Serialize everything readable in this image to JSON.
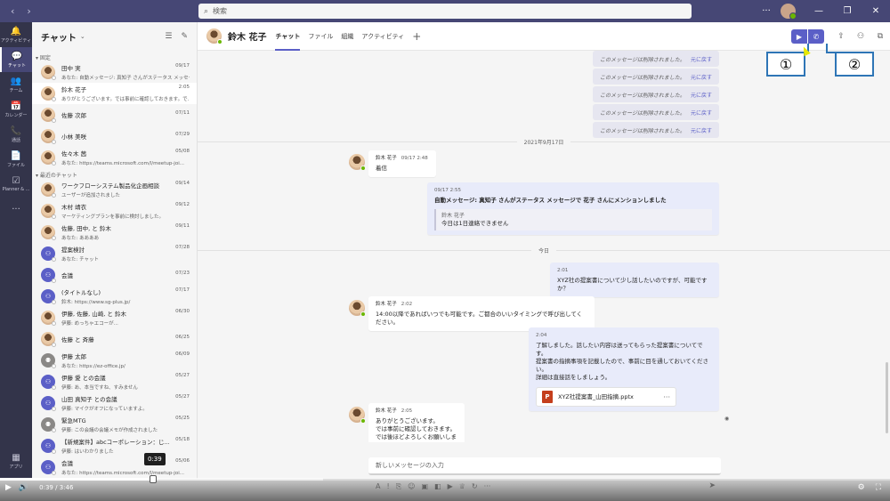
{
  "titlebar": {
    "back_icon": "chevron-left-icon",
    "forward_icon": "chevron-right-icon",
    "search_placeholder": "検索",
    "more": "···",
    "minimize": "—",
    "maximize": "❐",
    "close": "✕"
  },
  "rail": {
    "items": [
      {
        "icon": "bell-icon",
        "glyph": "🔔",
        "label": "アクティビティ"
      },
      {
        "icon": "chat-icon",
        "glyph": "💬",
        "label": "チャット",
        "active": true
      },
      {
        "icon": "teams-icon",
        "glyph": "👥",
        "label": "チーム"
      },
      {
        "icon": "calendar-icon",
        "glyph": "📅",
        "label": "カレンダー"
      },
      {
        "icon": "phone-icon",
        "glyph": "📞",
        "label": "通話"
      },
      {
        "icon": "file-icon",
        "glyph": "📄",
        "label": "ファイル"
      },
      {
        "icon": "planner-icon",
        "glyph": "☑",
        "label": "Planner & ..."
      },
      {
        "icon": "more-icon",
        "glyph": "···",
        "label": ""
      }
    ],
    "apps_label": "アプリ",
    "apps_glyph": "▦"
  },
  "chatlist": {
    "title": "チャット",
    "pinned_label": "固定",
    "recent_label": "最近のチャット",
    "pinned": [
      {
        "name": "田中 実",
        "time": "09/17",
        "preview": "あなた: 自動メッセージ: 真知子 さんがステータス メッセー...",
        "avatar": "person"
      },
      {
        "name": "鈴木 花子",
        "time": "2:05",
        "preview": "ありがとうございます。では事前に確認しておきます。で...",
        "avatar": "person",
        "selected": true
      },
      {
        "name": "佐藤 次郎",
        "time": "07/11",
        "preview": "",
        "avatar": "person"
      },
      {
        "name": "小林 美咲",
        "time": "07/29",
        "preview": "",
        "avatar": "person"
      },
      {
        "name": "佐々木 茜",
        "time": "05/08",
        "preview": "あなた: https://teams.microsoft.com/l/meetup-joi...",
        "avatar": "person"
      }
    ],
    "recent": [
      {
        "name": "ワークフローシステム製品化企画相談",
        "time": "09/14",
        "preview": "ユーザーが追加されました",
        "avatar": "person"
      },
      {
        "name": "木村 靖衣",
        "time": "09/12",
        "preview": "マーケティングプランを事前に検討しました。",
        "avatar": "person"
      },
      {
        "name": "佐藤, 田中, と 鈴木",
        "time": "09/11",
        "preview": "あなた: ああああ",
        "avatar": "person"
      },
      {
        "name": "提案検討",
        "time": "07/28",
        "preview": "あなた: チャット",
        "avatar": "group"
      },
      {
        "name": "会議",
        "time": "07/23",
        "preview": "",
        "avatar": "group"
      },
      {
        "name": "(タイトルなし)",
        "time": "07/17",
        "preview": "鈴木: https://www.sg-plus.jp/",
        "avatar": "group"
      },
      {
        "name": "伊藤, 佐藤, 山崎, と 鈴木",
        "time": "06/30",
        "preview": "伊藤: めっちゃエコーが...",
        "avatar": "person"
      },
      {
        "name": "佐藤 と 斉藤",
        "time": "06/25",
        "preview": "",
        "avatar": "person"
      },
      {
        "name": "伊藤 太郎",
        "time": "06/09",
        "preview": "あなた: https://ez-office.jp/",
        "avatar": "gray"
      },
      {
        "name": "伊藤 愛 との会議",
        "time": "05/27",
        "preview": "伊藤: あ、本当ですね、すみません",
        "avatar": "group"
      },
      {
        "name": "山田 真知子 との会議",
        "time": "05/27",
        "preview": "伊藤: マイクがオフになっていますよ。",
        "avatar": "group"
      },
      {
        "name": "緊急MTG",
        "time": "05/25",
        "preview": "伊藤: この会議の会議メモが作成されました",
        "avatar": "gray"
      },
      {
        "name": "【新規案件】abcコーポレーション：じ...",
        "time": "05/18",
        "preview": "伊藤: はいわかりました",
        "avatar": "group"
      },
      {
        "name": "会議",
        "time": "05/06",
        "preview": "あなた: https://teams.microsoft.com/l/meetup-joi...",
        "avatar": "group"
      }
    ]
  },
  "header": {
    "name": "鈴木 花子",
    "tabs": [
      "チャット",
      "ファイル",
      "組織",
      "アクティビティ"
    ],
    "add_tab": "+",
    "video_icon": "video-call-icon",
    "audio_icon": "phone-call-icon",
    "callout_1": "①",
    "callout_2": "②"
  },
  "messages": {
    "deleted_text": "このメッセージは削除されました。",
    "restore_text": "元に戻す",
    "date1": "2021年9月17日",
    "m1": {
      "name": "鈴木 花子",
      "time": "09/17 2:48",
      "text": "着信"
    },
    "m2": {
      "time": "09/17 2:55",
      "text": "自動メッセージ: 真知子 さんがステータス メッセージで 花子 さんにメンションしました",
      "quote_name": "鈴木 花子",
      "quote_text": "今日は1日連絡できません"
    },
    "date2": "今日",
    "m3": {
      "time": "2:01",
      "text": "XYZ社の提案書について少し話したいのですが、可能ですか？"
    },
    "m4": {
      "name": "鈴木 花子",
      "time": "2:02",
      "text": "14:00以降であればいつでも可能です。ご都合のいいタイミングで呼び出してください。"
    },
    "m5": {
      "time": "2:04",
      "line1": "了解しました。話したい内容は送ってもらった提案書についてです。",
      "line2": "提案書の指摘事項を記載したので、事前に目を通しておいてください。",
      "line3": "詳細は直接話をしましょう。",
      "file": "XYZ社提案書_山田指摘.pptx",
      "file_more": "···"
    },
    "m6": {
      "name": "鈴木 花子",
      "time": "2:05",
      "line1": "ありがとうございます。",
      "line2": "では事前に確認しておきます。",
      "line3": "では後ほどよろしくお願いします。"
    },
    "compose_placeholder": "新しいメッセージの入力"
  },
  "player": {
    "current": "0:39",
    "duration": "3:46",
    "separator": "/",
    "tooltip": "0:39",
    "progress": 0.172
  },
  "colors": {
    "titlebar": "#464775",
    "rail": "#33344a",
    "accent": "#5b5fc7",
    "callout_border": "#2e75b6"
  }
}
